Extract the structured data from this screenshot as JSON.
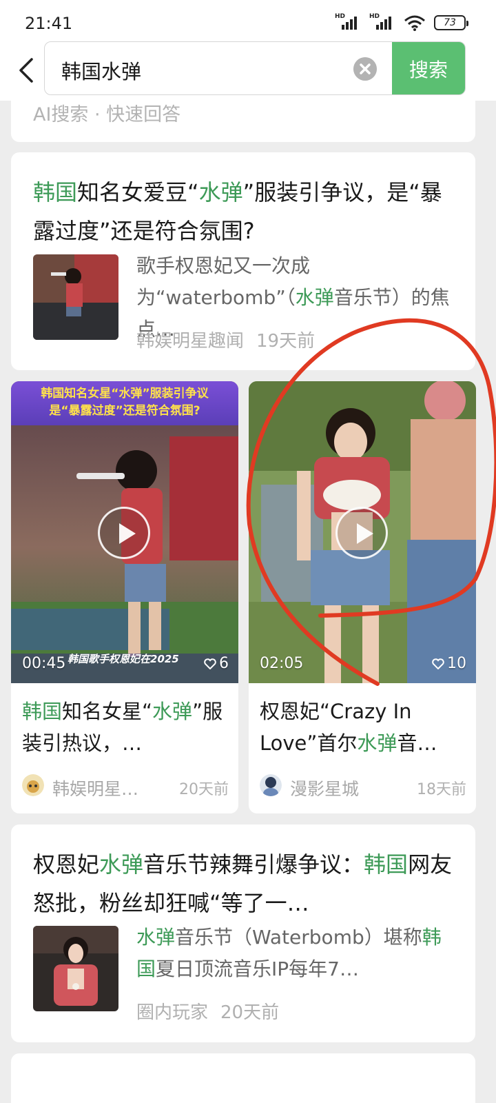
{
  "status_bar": {
    "time": "21:41",
    "signal_label_1": "HD",
    "signal_label_2": "HD",
    "battery": "73"
  },
  "search": {
    "query": "韩国水弹",
    "button_label": "搜索"
  },
  "ai_card": {
    "label": "AI搜索 · 快速回答"
  },
  "article1": {
    "title": [
      "韩国",
      "知名女爱豆“",
      "水弹",
      "”服装引争议，是“暴露过度”还是符合氛围?"
    ],
    "snippet": [
      "歌手权恩妃又一次成为“waterbomb”（",
      "水弹",
      "音乐节）的焦点…"
    ],
    "source": "韩娱明星趣闻",
    "time": "19天前"
  },
  "video1": {
    "banner_line1": "韩国知名女星“水弹”服装引争议",
    "banner_line2": "是“暴露过度”还是符合氛围?",
    "caption": "韩国歌手权恩妃在2025",
    "duration": "00:45",
    "likes": "6",
    "title": [
      "韩国",
      "知名女星“",
      "水弹",
      "”服装引热议，…"
    ],
    "author": "韩娱明星…",
    "time": "20天前"
  },
  "video2": {
    "duration": "02:05",
    "likes": "10",
    "title": [
      "权恩妃“Crazy In Love”首尔",
      "水弹",
      "音…"
    ],
    "author": "漫影星城",
    "time": "18天前"
  },
  "article2": {
    "title": [
      "权恩妃",
      "水弹",
      "音乐节辣舞引爆争议：",
      "韩国",
      "网友怒批，粉丝却狂喊“等了一…"
    ],
    "snippet": [
      "水弹",
      "音乐节（Waterbomb）堪称",
      "韩国",
      "夏日顶流音乐IP每年7…"
    ],
    "source": "圈内玩家",
    "time": "20天前"
  },
  "colors": {
    "highlight": "#3d9a57",
    "search_button": "#5bbf72",
    "annotation_circle": "#e03a22"
  }
}
